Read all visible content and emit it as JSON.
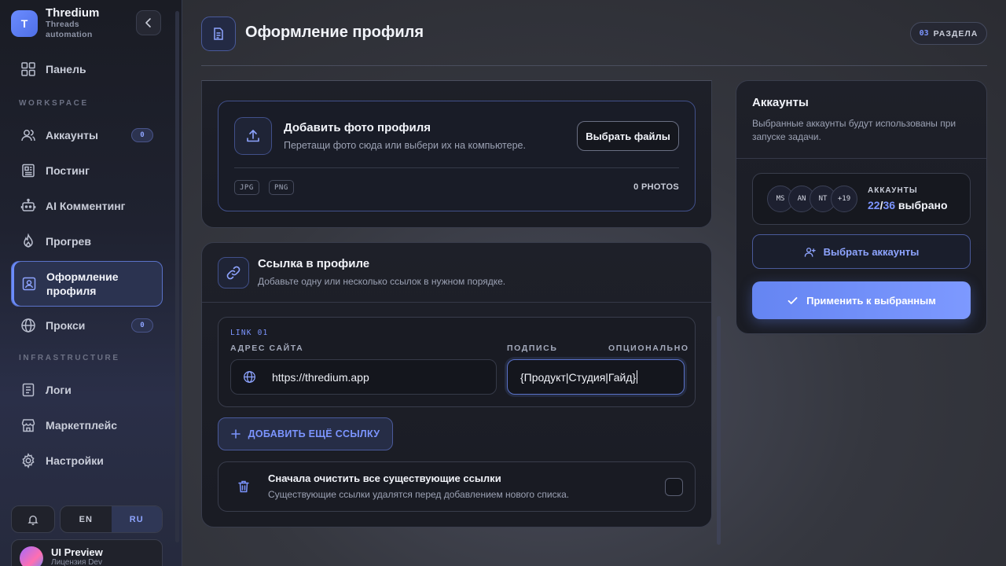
{
  "brand": {
    "name": "Thredium",
    "subtitle_line1": "Threads",
    "subtitle_line2": "automation",
    "logo_letter": "T"
  },
  "sidebar": {
    "dashboard": "Панель",
    "workspace_label": "WORKSPACE",
    "accounts": "Аккаунты",
    "accounts_badge": "0",
    "posting": "Постинг",
    "ai_commenting": "AI Комментинг",
    "warmup": "Прогрев",
    "profile_line1": "Оформление",
    "profile_line2": "профиля",
    "proxy": "Прокси",
    "proxy_badge": "0",
    "infrastructure_label": "INFRASTRUCTURE",
    "logs": "Логи",
    "marketplace": "Маркетплейс",
    "settings": "Настройки",
    "lang_en": "EN",
    "lang_ru": "RU",
    "user_name": "UI Preview",
    "user_sub": "Лицензия Dev"
  },
  "header": {
    "title": "Оформление профиля",
    "sections_num": "03",
    "sections_label": "РАЗДЕЛА"
  },
  "upload": {
    "title": "Добавить фото профиля",
    "subtitle": "Перетащи фото сюда или выбери их на компьютере.",
    "button": "Выбрать файлы",
    "tag_jpg": "JPG",
    "tag_png": "PNG",
    "count": "0 PHOTOS"
  },
  "links": {
    "title": "Ссылка в профиле",
    "subtitle": "Добавьте одну или несколько ссылок в нужном порядке.",
    "link_label": "LINK 01",
    "url_label": "АДРЕС САЙТА",
    "url_value": "https://thredium.app",
    "caption_label": "ПОДПИСЬ",
    "optional_label": "ОПЦИОНАЛЬНО",
    "caption_value": "{Продукт|Студия|Гайд}",
    "add_button": "ДОБАВИТЬ ЕЩЁ ССЫЛКУ",
    "clear_title": "Сначала очистить все существующие ссылки",
    "clear_sub": "Существующие ссылки удалятся перед добавлением нового списка."
  },
  "accounts_panel": {
    "title": "Аккаунты",
    "subtitle": "Выбранные аккаунты будут использованы при запуске задачи.",
    "avatars": [
      "MS",
      "AN",
      "NT",
      "+19"
    ],
    "label": "АККАУНТЫ",
    "selected": "22",
    "separator": "/",
    "total": "36",
    "selected_word": " выбрано",
    "select_button": "Выбрать аккаунты",
    "apply_button": "Применить к выбранным"
  },
  "colors": {
    "accent": "#7c95ff",
    "brand": "#6b8cff"
  }
}
